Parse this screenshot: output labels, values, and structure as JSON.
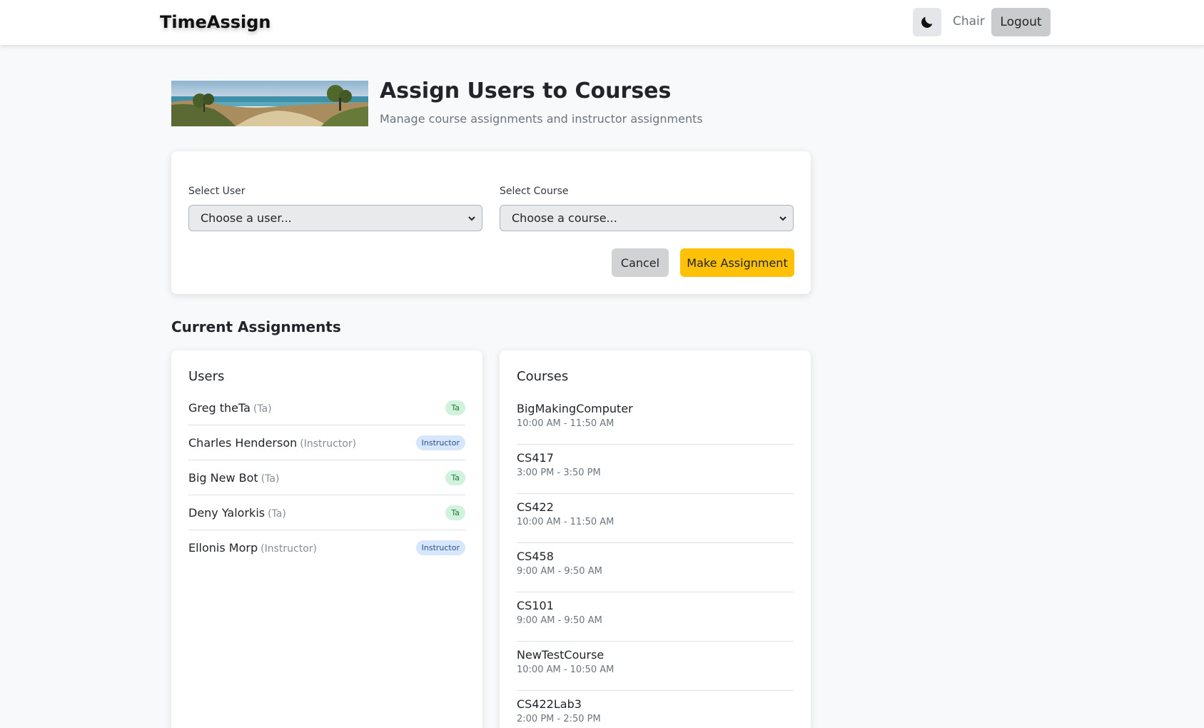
{
  "nav": {
    "brand": "TimeAssign",
    "role": "Chair",
    "logout_label": "Logout",
    "theme_icon": "moon-icon"
  },
  "header": {
    "title": "Assign Users to Courses",
    "subtitle": "Manage course assignments and instructor assignments"
  },
  "form": {
    "user_label": "Select User",
    "user_value": "Choose a user...",
    "course_label": "Select Course",
    "course_value": "Choose a course...",
    "cancel_label": "Cancel",
    "submit_label": "Make Assignment"
  },
  "assignments": {
    "title": "Current Assignments",
    "users_title": "Users",
    "courses_title": "Courses",
    "users": [
      {
        "name": "Greg theTa",
        "role": "(Ta)",
        "badge": "Ta",
        "type": "ta"
      },
      {
        "name": "Charles Henderson",
        "role": "(Instructor)",
        "badge": "Instructor",
        "type": "instructor"
      },
      {
        "name": "Big New Bot",
        "role": "(Ta)",
        "badge": "Ta",
        "type": "ta"
      },
      {
        "name": "Deny Yalorkis",
        "role": "(Ta)",
        "badge": "Ta",
        "type": "ta"
      },
      {
        "name": "Ellonis Morp",
        "role": "(Instructor)",
        "badge": "Instructor",
        "type": "instructor"
      }
    ],
    "courses": [
      {
        "name": "BigMakingComputer",
        "time": "10:00 AM - 11:50 AM"
      },
      {
        "name": "CS417",
        "time": "3:00 PM - 3:50 PM"
      },
      {
        "name": "CS422",
        "time": "10:00 AM - 11:50 AM"
      },
      {
        "name": "CS458",
        "time": "9:00 AM - 9:50 AM"
      },
      {
        "name": "CS101",
        "time": "9:00 AM - 9:50 AM"
      },
      {
        "name": "NewTestCourse",
        "time": "10:00 AM - 10:50 AM"
      },
      {
        "name": "CS422Lab3",
        "time": "2:00 PM - 2:50 PM"
      }
    ]
  },
  "colors": {
    "accent": "#ffc107",
    "ta_badge": "#d1f2dc",
    "instructor_badge": "#d6e6fb"
  }
}
